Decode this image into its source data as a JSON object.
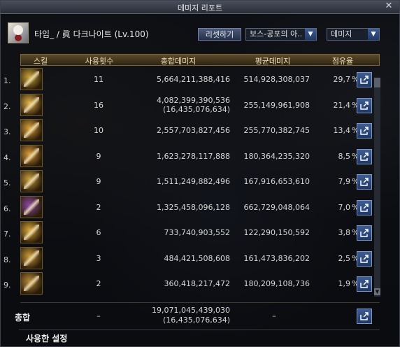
{
  "window": {
    "title": "데미지 리포트"
  },
  "character": {
    "name": "타임_ / 眞 다크나이트 (Lv.100)"
  },
  "controls": {
    "reset_label": "리셋하기",
    "boss_select": "보스-공포의 아..",
    "metric_select": "데미지"
  },
  "table": {
    "headers": {
      "skill": "스킬",
      "count": "사용횟수",
      "total": "총합데미지",
      "avg": "평균데미지",
      "share": "점유율"
    },
    "pct_symbol": "%",
    "rows": [
      {
        "num": "1.",
        "count": "11",
        "total": "5,664,211,388,416",
        "avg": "514,928,308,037",
        "pct": "29,7",
        "icon_color": "#c9a53a"
      },
      {
        "num": "2.",
        "count": "16",
        "total": "4,082,399,390,536",
        "total2": "(16,435,076,634)",
        "avg": "255,149,961,908",
        "pct": "21,4",
        "icon_color": "#e2b24a"
      },
      {
        "num": "3.",
        "count": "10",
        "total": "2,557,703,827,456",
        "avg": "255,770,382,745",
        "pct": "13,4",
        "icon_color": "#d9a23a"
      },
      {
        "num": "4.",
        "count": "9",
        "total": "1,623,278,117,888",
        "avg": "180,364,235,320",
        "pct": "8,5",
        "icon_color": "#d89a3a"
      },
      {
        "num": "5.",
        "count": "9",
        "total": "1,511,249,882,496",
        "avg": "167,916,653,610",
        "pct": "7,9",
        "icon_color": "#c9a040"
      },
      {
        "num": "6.",
        "count": "2",
        "total": "1,325,458,096,128",
        "avg": "662,729,048,064",
        "pct": "7,0",
        "icon_color": "#8a4aa0"
      },
      {
        "num": "7.",
        "count": "6",
        "total": "733,740,903,552",
        "avg": "122,290,150,592",
        "pct": "3,8",
        "icon_color": "#d8a83a"
      },
      {
        "num": "8.",
        "count": "3",
        "total": "484,421,508,608",
        "avg": "161,473,836,202",
        "pct": "2,5",
        "icon_color": "#c99a38"
      },
      {
        "num": "9.",
        "count": "2",
        "total": "360,418,217,472",
        "avg": "180,209,108,736",
        "pct": "1,9",
        "icon_color": "#b58a3a"
      }
    ],
    "summary": {
      "label": "총합",
      "count": "–",
      "total": "19,071,045,439,030",
      "total2": "(16,435,076,634)",
      "avg": "–"
    }
  },
  "footer": {
    "used_settings": "사용한 설정"
  },
  "colors": {
    "header_gold": "#f0e2b8",
    "accent_blue": "#3f5d92"
  }
}
